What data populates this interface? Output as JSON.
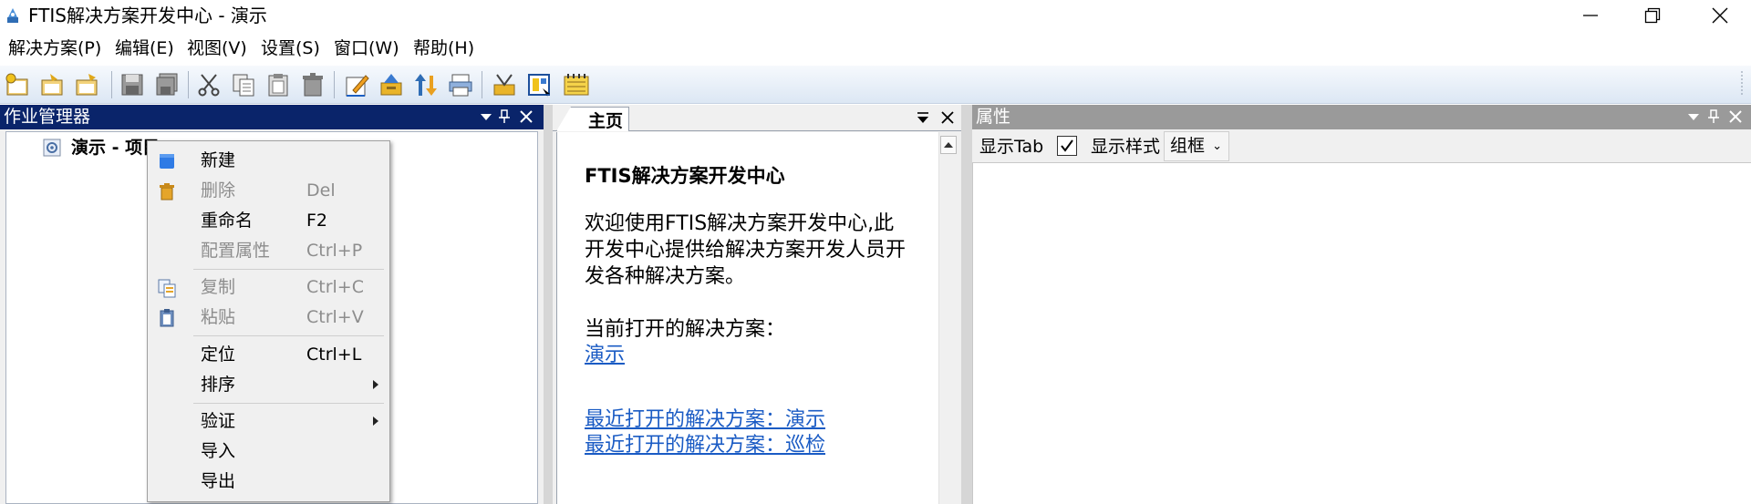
{
  "window": {
    "title": "FTIS解决方案开发中心 - 演示"
  },
  "menubar": {
    "items": [
      "解决方案(P)",
      "编辑(E)",
      "视图(V)",
      "设置(S)",
      "窗口(W)",
      "帮助(H)"
    ]
  },
  "toolbar": {
    "icons": [
      "new-solution-icon",
      "open-solution-icon",
      "open-folder-icon",
      "save-icon",
      "save-all-icon",
      "cut-icon",
      "copy-icon",
      "paste-icon",
      "delete-icon",
      "edit-icon",
      "build-icon",
      "publish-icon",
      "print-icon",
      "tools-icon",
      "layout-icon",
      "notepad-icon"
    ]
  },
  "job_manager": {
    "title": "作业管理器",
    "tree": {
      "root_label": "演示 - 项目"
    }
  },
  "context_menu": {
    "items": [
      {
        "label": "新建",
        "shortcut": "",
        "enabled": true,
        "icon": "new-icon"
      },
      {
        "label": "删除",
        "shortcut": "Del",
        "enabled": false,
        "icon": "delete-icon"
      },
      {
        "label": "重命名",
        "shortcut": "F2",
        "enabled": true,
        "icon": ""
      },
      {
        "label": "配置属性",
        "shortcut": "Ctrl+P",
        "enabled": false,
        "icon": ""
      },
      {
        "label": "复制",
        "shortcut": "Ctrl+C",
        "enabled": false,
        "icon": "copy-icon"
      },
      {
        "label": "粘贴",
        "shortcut": "Ctrl+V",
        "enabled": false,
        "icon": "paste-icon"
      },
      {
        "label": "定位",
        "shortcut": "Ctrl+L",
        "enabled": true,
        "icon": ""
      },
      {
        "label": "排序",
        "shortcut": "",
        "enabled": true,
        "submenu": true
      },
      {
        "label": "验证",
        "shortcut": "",
        "enabled": true,
        "submenu": true
      },
      {
        "label": "导入",
        "shortcut": "",
        "enabled": true
      },
      {
        "label": "导出",
        "shortcut": "",
        "enabled": true
      }
    ]
  },
  "home": {
    "tab_label": "主页",
    "heading": "FTIS解决方案开发中心",
    "welcome": "欢迎使用FTIS解决方案开发中心,此开发中心提供给解决方案开发人员开发各种解决方案。",
    "current_label": "当前打开的解决方案：",
    "current_link": "演示",
    "recent_links": [
      "最近打开的解决方案：演示",
      "最近打开的解决方案：巡检"
    ]
  },
  "properties": {
    "title": "属性",
    "show_tab_label": "显示Tab",
    "show_tab_checked": true,
    "show_style_label": "显示样式",
    "style_value": "组框"
  },
  "colors": {
    "active_header": "#0a246a",
    "inactive_header": "#9a9a9a",
    "link": "#1a5bc4"
  }
}
